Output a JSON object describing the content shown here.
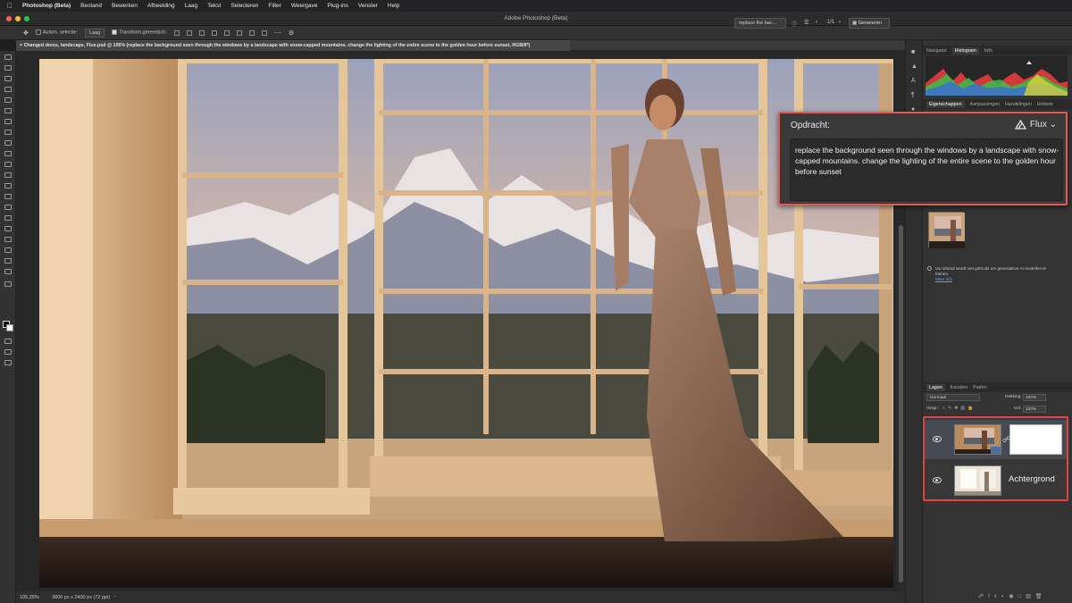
{
  "menubar": {
    "app_name": "Photoshop (Beta)",
    "items": [
      "Bestand",
      "Bewerken",
      "Afbeelding",
      "Laag",
      "Tekst",
      "Selecteren",
      "Filter",
      "Weergave",
      "Plug-ins",
      "Venster",
      "Help"
    ]
  },
  "titlebar": {
    "title": "Adobe Photoshop (Beta)",
    "search_text": "replace the bac...",
    "page_counter": "1/1",
    "generate_label": "Genereren"
  },
  "options": {
    "auto_select_label": "Autom. selectie:",
    "layer_select": "Laag",
    "transform_label": "Transform.gereedsch."
  },
  "document": {
    "tab_title": "Changed dress, landscape, Flux.psd @ 105% (replace the background seen through the windows by a landscape with snow-capped mountains. change the lighting of the entire scene to the golden hour before sunset, RGB/8*)"
  },
  "status": {
    "zoom": "105,25%",
    "dimensions": "3806 px x 2400 px (72 ppi)"
  },
  "panels": {
    "top_tabs": [
      "Navigator",
      "Histogram",
      "Info"
    ],
    "top_active": "Histogram",
    "mid_tabs": [
      "Eigenschappen",
      "Aanpassingen",
      "Handelingen",
      "Historie"
    ],
    "mid_active": "Eigenschappen",
    "note_text": "Uw inhoud wordt niet gebruikt om generatieve AI-modellen te trainen.",
    "note_link": "Meer info",
    "layer_tabs": [
      "Lagen",
      "Kanalen",
      "Paden"
    ],
    "layer_active": "Lagen",
    "blend_mode": "Normaal",
    "opacity_label": "Dekking:",
    "opacity_value": "100%",
    "lock_label": "Vergr.:",
    "fill_label": "Vul:",
    "fill_value": "100%"
  },
  "layers": [
    {
      "name": "",
      "has_mask": true,
      "selected": true
    },
    {
      "name": "Achtergrond",
      "has_mask": false,
      "selected": false
    }
  ],
  "prompt": {
    "label": "Opdracht:",
    "model": "Flux",
    "text": "replace the background seen through the windows by a landscape with snow-capped mountains. change the lighting of the entire scene to the golden hour before sunset"
  },
  "colors": {
    "accent_red": "#e05a5a",
    "selection_blue": "#4a6fa5",
    "link_blue": "#5ea6f5"
  }
}
